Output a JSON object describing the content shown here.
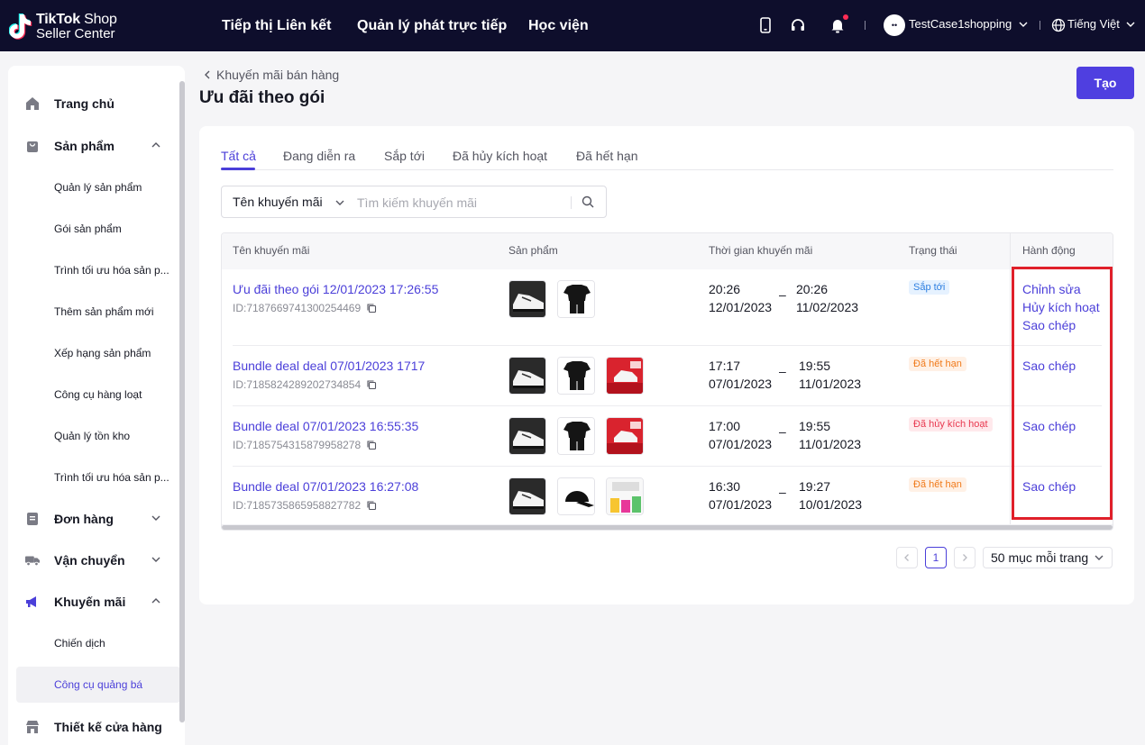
{
  "app": {
    "logo_line1_bold": "TikTok",
    "logo_line1_light": " Shop",
    "logo_line2": "Seller Center"
  },
  "topnav": {
    "items": [
      "Tiếp thị Liên kết",
      "Quản lý phát trực tiếp",
      "Học viện"
    ],
    "avatar_text": "••",
    "user_name": "TestCase1shopping",
    "language": "Tiếng Việt"
  },
  "sidebar": {
    "home": "Trang chủ",
    "products": "Sản phẩm",
    "product_subs": [
      "Quản lý sản phẩm",
      "Gói sản phẩm",
      "Trình tối ưu hóa sản p...",
      "Thêm sản phẩm mới",
      "Xếp hạng sản phẩm",
      "Công cụ hàng loạt",
      "Quản lý tồn kho",
      "Trình tối ưu hóa sản p..."
    ],
    "orders": "Đơn hàng",
    "shipping": "Vận chuyển",
    "promotions": "Khuyến mãi",
    "promo_subs": [
      "Chiến dịch",
      "Công cụ quảng bá"
    ],
    "store_design": "Thiết kế cửa hàng"
  },
  "page": {
    "breadcrumb": "Khuyến mãi bán hàng",
    "title": "Ưu đãi theo gói",
    "create_label": "Tạo"
  },
  "tabs": [
    "Tất cả",
    "Đang diễn ra",
    "Sắp tới",
    "Đã hủy kích hoạt",
    "Đã hết hạn"
  ],
  "search": {
    "field_select": "Tên khuyến mãi",
    "placeholder": "Tìm kiếm khuyến mãi"
  },
  "table": {
    "headers": [
      "Tên khuyến mãi",
      "Sản phẩm",
      "Thời gian khuyến mãi",
      "Trạng thái",
      "Hành động"
    ],
    "rows": [
      {
        "name": "Ưu đãi theo gói 12/01/2023 17:26:55",
        "id": "ID:7187669741300254469",
        "products": [
          "sneaker",
          "tshirt-set"
        ],
        "start_time": "20:26",
        "start_date": "12/01/2023",
        "end_time": "20:26",
        "end_date": "11/02/2023",
        "status": "Sắp tới",
        "actions": [
          "Chỉnh sửa",
          "Hủy kích hoạt",
          "Sao chép"
        ]
      },
      {
        "name": "Bundle deal deal 07/01/2023 1717",
        "id": "ID:7185824289202734854",
        "products": [
          "sneaker",
          "tshirt-set",
          "red-promo"
        ],
        "start_time": "17:17",
        "start_date": "07/01/2023",
        "end_time": "19:55",
        "end_date": "11/01/2023",
        "status": "Đã hết hạn",
        "actions": [
          "Sao chép"
        ]
      },
      {
        "name": "Bundle deal 07/01/2023 16:55:35",
        "id": "ID:7185754315879958278",
        "products": [
          "sneaker",
          "tshirt-set",
          "red-promo"
        ],
        "start_time": "17:00",
        "start_date": "07/01/2023",
        "end_time": "19:55",
        "end_date": "11/01/2023",
        "status": "Đã hủy kích hoạt",
        "actions": [
          "Sao chép"
        ]
      },
      {
        "name": "Bundle deal 07/01/2023 16:27:08",
        "id": "ID:7185735865958827782",
        "products": [
          "sneaker",
          "cap",
          "colorful-items"
        ],
        "start_time": "16:30",
        "start_date": "07/01/2023",
        "end_time": "19:27",
        "end_date": "10/01/2023",
        "status": "Đã hết hạn",
        "actions": [
          "Sao chép"
        ]
      }
    ]
  },
  "pagination": {
    "current_page": "1",
    "page_size": "50 mục mỗi trang"
  },
  "colors": {
    "accent": "#4b3fd9",
    "topbar": "#0e0e2c",
    "highlight": "#e0202a"
  }
}
